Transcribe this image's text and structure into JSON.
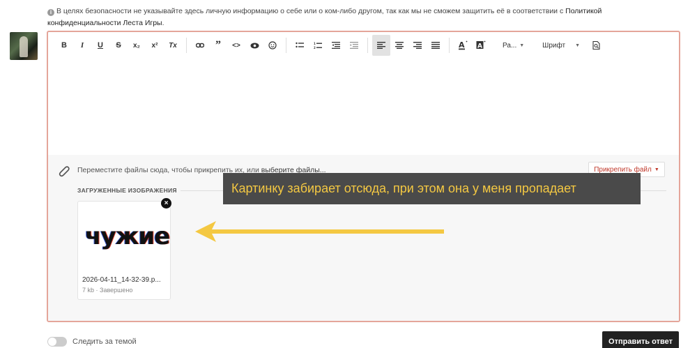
{
  "notice": {
    "text": "В целях безопасности не указывайте здесь личную информацию о себе или о ком-либо другом, так как мы не сможем защитить её в соответствии с ",
    "policy_link": "Политикой конфиденциальности Леста Игры",
    "suffix": "."
  },
  "toolbar": {
    "bold": "B",
    "italic": "I",
    "underline": "U",
    "strike": "S",
    "subscript": "x₂",
    "superscript": "x²",
    "clear_format": "Tx",
    "size_select": "Ра...",
    "font_select": "Шрифт"
  },
  "attach": {
    "drop_text": "Переместите файлы сюда, чтобы прикрепить их, или ",
    "choose_link": "выберите файлы...",
    "attach_button": "Прикрепить файл",
    "uploaded_label": "ЗАГРУЖЕННЫЕ ИЗОБРАЖЕНИЯ",
    "files": [
      {
        "preview_text": "чужие",
        "name": "2026-04-11_14-32-39.p...",
        "meta": "7 kb · Завершено"
      }
    ]
  },
  "callout": {
    "text": "Картинку забирает отсюда, при этом она у меня пропадает",
    "color": "#f4c842"
  },
  "footer": {
    "follow_label": "Следить за темой",
    "submit": "Отправить ответ"
  }
}
